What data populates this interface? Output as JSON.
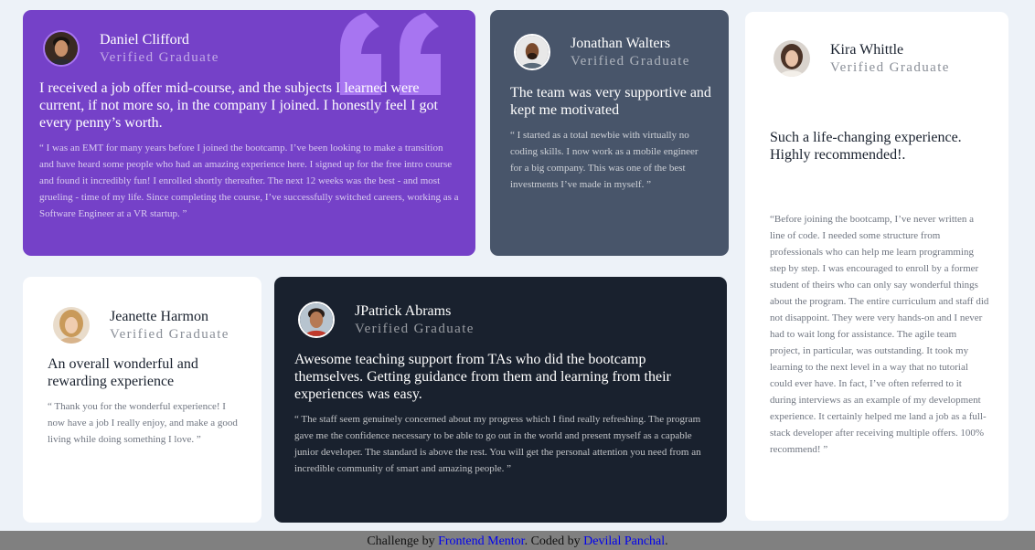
{
  "testimonials": [
    {
      "name": "Daniel Clifford",
      "role": "Verified Graduate",
      "headline": "I received a job offer mid-course, and the subjects I learned were current, if not more so, in the company I joined. I honestly feel I got every penny’s worth.",
      "body": "“ I was an EMT for many years before I joined the bootcamp. I’ve been looking to make a transition and have heard some people who had an amazing experience here. I signed up for the free intro course and found it incredibly fun! I enrolled shortly thereafter. The next 12 weeks was the best - and most grueling - time of my life. Since completing the course, I’ve successfully switched careers, working as a Software Engineer at a VR startup. ”",
      "card_color": "#7541c8"
    },
    {
      "name": "Jonathan Walters",
      "role": "Verified Graduate",
      "headline": "The team was very supportive and kept me motivated",
      "body": "“ I started as a total newbie with virtually no coding skills. I now work as a mobile engineer for a big company. This was one of the best investments I’ve made in myself. ”",
      "card_color": "#48556a"
    },
    {
      "name": "Kira Whittle",
      "role": "Verified Graduate",
      "headline": "Such a life-changing experience. Highly recommended!.",
      "body": "“Before joining the bootcamp, I’ve never written a line of code. I needed some structure from professionals who can help me learn programming step by step. I was encouraged to enroll by a former student of theirs who can only say wonderful things about the program. The entire curriculum and staff did not disappoint. They were very hands-on and I never had to wait long for assistance. The agile team project, in particular, was outstanding. It took my learning to the next level in a way that no tutorial could ever have. In fact, I’ve often referred to it during interviews as an example of my development experience. It certainly helped me land a job as a full-stack developer after receiving multiple offers. 100% recommend! ”",
      "card_color": "#ffffff"
    },
    {
      "name": "Jeanette Harmon",
      "role": "Verified Graduate",
      "headline": "An overall wonderful and rewarding experience",
      "body": "“ Thank you for the wonderful experience! I now have a job I really enjoy, and make a good living while doing something I love. ”",
      "card_color": "#ffffff"
    },
    {
      "name": "JPatrick Abrams",
      "role": "Verified Graduate",
      "headline": "Awesome teaching support from TAs who did the bootcamp themselves. Getting guidance from them and learning from their experiences was easy.",
      "body": "“ The staff seem genuinely concerned about my progress which I find really refreshing. The program gave me the confidence necessary to be able to go out in the world and present myself as a capable junior developer. The standard is above the rest. You will get the personal attention you need from an incredible community of smart and amazing people. ”",
      "card_color": "#19212e"
    }
  ],
  "decoration": {
    "quote_icon": "quotation-icon",
    "quote_color": "#a775f1"
  },
  "footer": {
    "prefix": "Challenge by ",
    "challenge_link": "Frontend Mentor",
    "middle": ". Coded by ",
    "author_link": "Devilal Panchal",
    "suffix": "."
  }
}
